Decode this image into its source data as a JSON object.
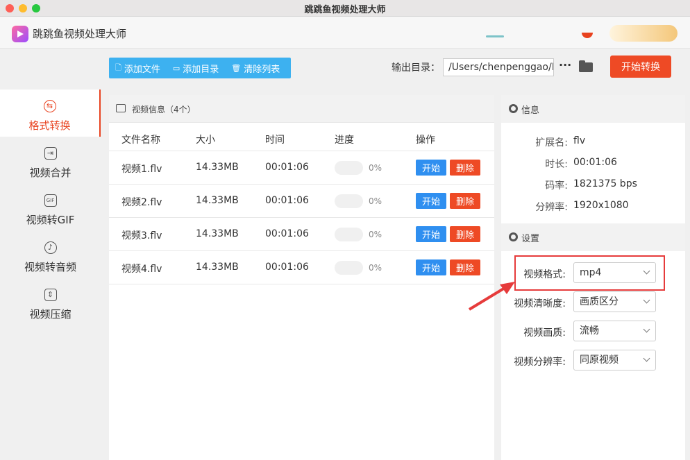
{
  "window": {
    "title": "跳跳鱼视频处理大师"
  },
  "header": {
    "app_name": "跳跳鱼视频处理大师"
  },
  "sidebar": {
    "items": [
      {
        "label": "格式转换",
        "icon": "format-convert-icon",
        "active": true
      },
      {
        "label": "视频合并",
        "icon": "video-merge-icon",
        "active": false
      },
      {
        "label": "视频转GIF",
        "icon": "gif-icon",
        "active": false
      },
      {
        "label": "视频转音频",
        "icon": "audio-icon",
        "active": false
      },
      {
        "label": "视频压缩",
        "icon": "compress-icon",
        "active": false
      }
    ]
  },
  "toolbar": {
    "add_file": "添加文件",
    "add_dir": "添加目录",
    "clear_list": "清除列表"
  },
  "output": {
    "label": "输出目录：",
    "path": "/Users/chenpenggao/Desktop",
    "more": "···"
  },
  "start_all": "开始转换",
  "video_panel": {
    "title": "视频信息（4个）",
    "columns": [
      "文件名称",
      "大小",
      "时间",
      "进度",
      "操作"
    ],
    "rows": [
      {
        "name": "视频1.flv",
        "size": "14.33MB",
        "time": "00:01:06",
        "progress": "0%"
      },
      {
        "name": "视频2.flv",
        "size": "14.33MB",
        "time": "00:01:06",
        "progress": "0%"
      },
      {
        "name": "视频3.flv",
        "size": "14.33MB",
        "time": "00:01:06",
        "progress": "0%"
      },
      {
        "name": "视频4.flv",
        "size": "14.33MB",
        "time": "00:01:06",
        "progress": "0%"
      }
    ],
    "start_label": "开始",
    "delete_label": "删除"
  },
  "info": {
    "title": "信息",
    "fields": [
      {
        "key": "扩展名:",
        "value": "flv"
      },
      {
        "key": "时长:",
        "value": "00:01:06"
      },
      {
        "key": "码率:",
        "value": "1821375 bps"
      },
      {
        "key": "分辨率:",
        "value": "1920x1080"
      }
    ]
  },
  "settings": {
    "title": "设置",
    "fields": [
      {
        "key": "视频格式:",
        "value": "mp4"
      },
      {
        "key": "视频清晰度:",
        "value": "画质区分"
      },
      {
        "key": "视频画质:",
        "value": "流畅"
      },
      {
        "key": "视频分辨率:",
        "value": "同原视频"
      }
    ]
  },
  "colors": {
    "accent": "#ee4a25",
    "primary": "#2f8ff0",
    "toolbar": "#3db1f0",
    "highlight": "#e63b3b"
  }
}
